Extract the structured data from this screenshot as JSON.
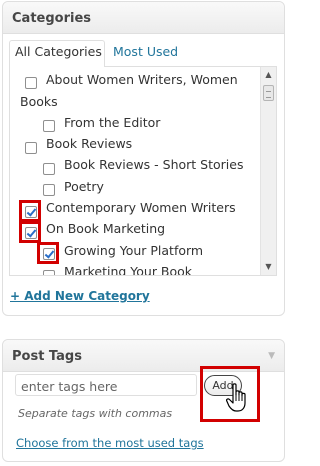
{
  "categories_box": {
    "title": "Categories",
    "tabs": {
      "all": "All Categories",
      "most_used": "Most Used"
    },
    "items": [
      {
        "label": "About Women Writers, Women",
        "continuation": "Books",
        "checked": false,
        "highlighted": false
      },
      {
        "label": "From the Editor",
        "checked": false,
        "highlighted": false
      },
      {
        "label": "Book Reviews",
        "checked": false,
        "highlighted": false
      },
      {
        "label": "Book Reviews - Short Stories",
        "checked": false,
        "highlighted": false
      },
      {
        "label": "Poetry",
        "checked": false,
        "highlighted": false
      },
      {
        "label": "Contemporary Women Writers",
        "checked": true,
        "highlighted": true
      },
      {
        "label": "On Book Marketing",
        "checked": true,
        "highlighted": true
      },
      {
        "label": "Growing Your Platform",
        "checked": true,
        "highlighted": true
      },
      {
        "label": "Marketing Your Book",
        "checked": false,
        "highlighted": false
      }
    ],
    "add_new": "+ Add New Category"
  },
  "tags_box": {
    "title": "Post Tags",
    "input_placeholder": "enter tags here",
    "add_button": "Add",
    "hint": "Separate tags with commas",
    "most_used_link": "Choose from the most used tags"
  },
  "colors": {
    "link": "#21759b",
    "highlight": "#d20000",
    "check": "#2a6ec8"
  },
  "icons": [
    "scroll-up-arrow-icon",
    "scroll-down-arrow-icon",
    "collapse-arrow-icon",
    "hand-pointer-cursor-icon"
  ]
}
